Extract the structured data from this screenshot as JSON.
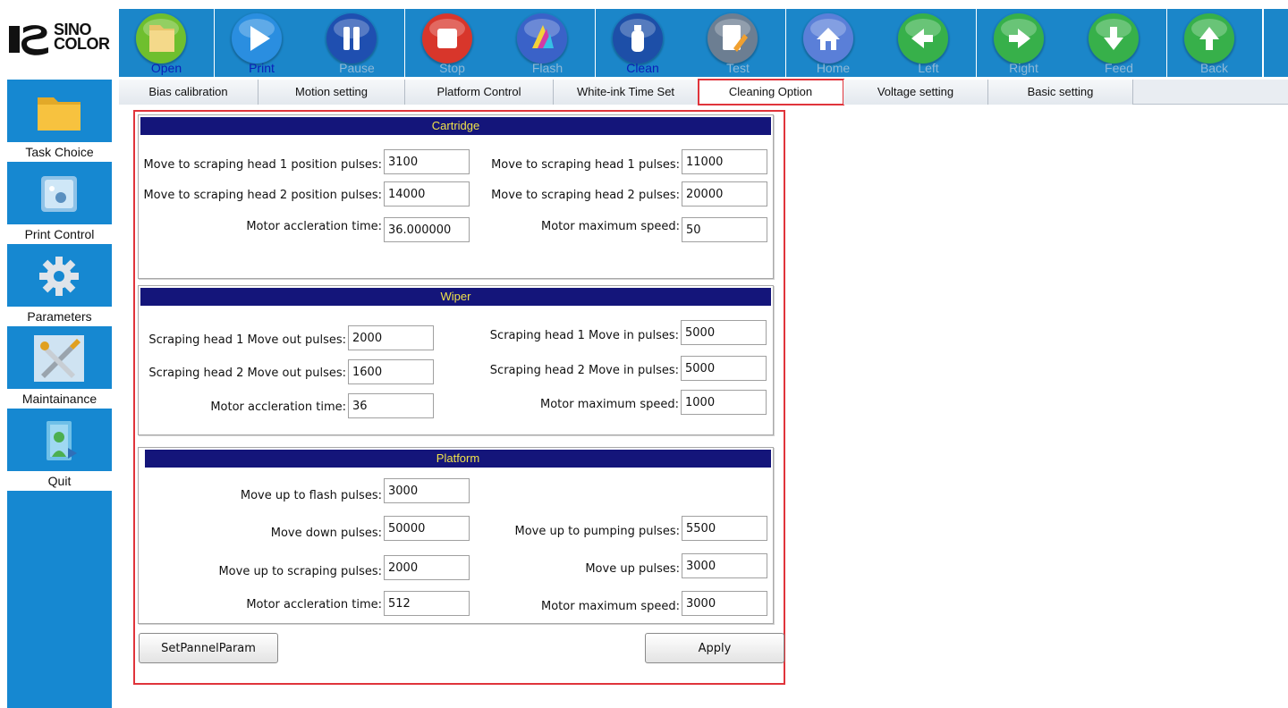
{
  "brand": {
    "line1": "SINO",
    "line2": "COLOR"
  },
  "toolbar": [
    {
      "label": "Open",
      "icon": "folder-icon",
      "enabled": true,
      "color": "#6fbf2e"
    },
    {
      "label": "Print",
      "icon": "play-icon",
      "enabled": true,
      "color": "#2a8ee0"
    },
    {
      "label": "Pause",
      "icon": "pause-icon",
      "enabled": false,
      "color": "#1f4fb0"
    },
    {
      "label": "Stop",
      "icon": "stop-icon",
      "enabled": false,
      "color": "#d8362b"
    },
    {
      "label": "Flash",
      "icon": "ink-drops-icon",
      "enabled": false,
      "color": "#3a62c8"
    },
    {
      "label": "Clean",
      "icon": "ink-bottle-icon",
      "enabled": true,
      "color": "#1d4fa8"
    },
    {
      "label": "Test",
      "icon": "test-pen-icon",
      "enabled": false,
      "color": "#6c7e92"
    },
    {
      "label": "Home",
      "icon": "home-icon",
      "enabled": false,
      "color": "#5a7fd8"
    },
    {
      "label": "Left",
      "icon": "arrow-left-icon",
      "enabled": false,
      "color": "#37b04a"
    },
    {
      "label": "Right",
      "icon": "arrow-right-icon",
      "enabled": false,
      "color": "#37b04a"
    },
    {
      "label": "Feed",
      "icon": "arrow-down-icon",
      "enabled": false,
      "color": "#37b04a"
    },
    {
      "label": "Back",
      "icon": "arrow-up-icon",
      "enabled": false,
      "color": "#37b04a"
    }
  ],
  "sidebar": [
    {
      "label": "Task Choice",
      "icon": "folder-icon"
    },
    {
      "label": "Print Control",
      "icon": "print-control-icon"
    },
    {
      "label": "Parameters",
      "icon": "gear-icon"
    },
    {
      "label": "Maintainance",
      "icon": "tools-icon"
    },
    {
      "label": "Quit",
      "icon": "quit-icon"
    }
  ],
  "tabs": [
    {
      "label": "Bias calibration",
      "active": false
    },
    {
      "label": "Motion setting",
      "active": false
    },
    {
      "label": "Platform Control",
      "active": false
    },
    {
      "label": "White-ink Time Set",
      "active": false
    },
    {
      "label": "Cleaning Option",
      "active": true
    },
    {
      "label": "Voltage setting",
      "active": false
    },
    {
      "label": "Basic setting",
      "active": false
    }
  ],
  "cartridge": {
    "title": "Cartridge",
    "head1_position_label": "Move to scraping head 1 position pulses:",
    "head1_position_value": "3100",
    "head1_pulses_label": "Move to scraping head 1 pulses:",
    "head1_pulses_value": "11000",
    "head2_position_label": "Move to scraping head 2 position pulses:",
    "head2_position_value": "14000",
    "head2_pulses_label": "Move to scraping head 2 pulses:",
    "head2_pulses_value": "20000",
    "accel_label": "Motor accleration time:",
    "accel_value": "36.000000",
    "speed_label": "Motor maximum speed:",
    "speed_value": "50"
  },
  "wiper": {
    "title": "Wiper",
    "head1_out_label": "Scraping head 1 Move out pulses:",
    "head1_out_value": "2000",
    "head1_in_label": "Scraping head 1 Move in pulses:",
    "head1_in_value": "5000",
    "head2_out_label": "Scraping head 2 Move out pulses:",
    "head2_out_value": "1600",
    "head2_in_label": "Scraping head 2 Move in pulses:",
    "head2_in_value": "5000",
    "accel_label": "Motor accleration time:",
    "accel_value": "36",
    "speed_label": "Motor maximum speed:",
    "speed_value": "1000"
  },
  "platform": {
    "title": "Platform",
    "flash_label": "Move up to flash pulses:",
    "flash_value": "3000",
    "down_label": "Move down pulses:",
    "down_value": "50000",
    "pumping_label": "Move up to pumping pulses:",
    "pumping_value": "5500",
    "scraping_label": "Move up to scraping pulses:",
    "scraping_value": "2000",
    "up_label": "Move up pulses:",
    "up_value": "3000",
    "accel_label": "Motor accleration time:",
    "accel_value": "512",
    "speed_label": "Motor maximum speed:",
    "speed_value": "3000"
  },
  "buttons": {
    "set_pannel": "SetPannelParam",
    "apply": "Apply"
  },
  "colors": {
    "accent_blue": "#1688d1",
    "group_header": "#14157a",
    "group_header_text": "#f0e24a",
    "highlight_red": "#e0343b"
  }
}
